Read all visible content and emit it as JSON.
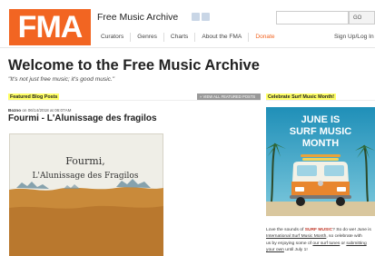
{
  "header": {
    "logo_text": "FMA",
    "site_title": "Free Music Archive",
    "social": [
      "facebook-icon",
      "twitter-icon"
    ],
    "search": {
      "value": "",
      "button": "GO"
    },
    "nav": [
      "Curators",
      "Genres",
      "Charts",
      "About the FMA",
      "Donate"
    ],
    "signup": "Sign Up/Log In"
  },
  "main": {
    "welcome": "Welcome to the Free Music Archive",
    "tagline": "\"It's not just free music; it's good music.\""
  },
  "blog": {
    "label": "Featured Blog Posts",
    "view_all": "» VIEW ALL FEATURED POSTS",
    "post": {
      "author": "Bozno",
      "date": "on 06/14/2018 at 06:07AM",
      "title": "Fourmi - L'Alunissage des fragilos",
      "art_line1": "Fourmi,",
      "art_line2": "L'Alunissage des Fragilos"
    }
  },
  "promo": {
    "label": "Celebrate Surf Music Month!",
    "banner_line1": "JUNE IS",
    "banner_line2": "SURF MUSIC",
    "banner_line3": "MONTH",
    "text_1": "Love the sounds of ",
    "text_hl": "SURF MUSIC",
    "text_2": "? So do we! June is",
    "link_1": "International Surf Music Month",
    "text_3": ", so celebrate with",
    "text_4": "us by enjoying some of ",
    "link_2": "our surf tunes",
    "text_5": " or ",
    "link_3": "submitting",
    "link_4": "your own",
    "text_6": " until July 1!"
  },
  "colors": {
    "brand": "#f26522",
    "highlight": "#ffff66"
  }
}
